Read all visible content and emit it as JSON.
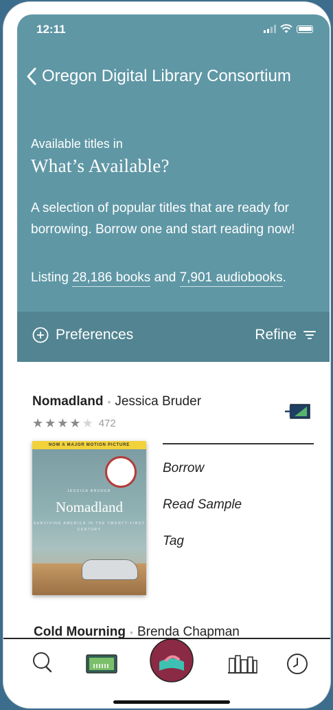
{
  "status": {
    "time": "12:11"
  },
  "header": {
    "back_label": "Oregon Digital Library Consortium",
    "available_in": "Available titles in",
    "title": "What’s Available?",
    "description": "A selection of popular titles that are ready for borrowing. Borrow one and start reading now!",
    "listing_prefix": "Listing",
    "books_count": "28,186 books",
    "and": "and",
    "audiobooks_count": "7,901 audiobooks",
    "listing_suffix": "."
  },
  "filterbar": {
    "preferences_label": "Preferences",
    "refine_label": "Refine"
  },
  "book": {
    "title": "Nomadland",
    "author": "Jessica Bruder",
    "rating_stars": 4,
    "rating_count": "472",
    "cover": {
      "banner": "NOW A MAJOR MOTION PICTURE",
      "author": "JESSICA BRUDER",
      "title": "Nomadland",
      "subtitle": "SURVIVING AMERICA IN THE TWENTY-FIRST CENTURY"
    },
    "actions": [
      "Borrow",
      "Read Sample",
      "Tag"
    ]
  },
  "next_book": {
    "title": "Cold Mourning",
    "author": "Brenda Chapman"
  },
  "colors": {
    "header": "#5f97a5",
    "filterbar": "#528491",
    "accent": "#8b2a44"
  },
  "tabs": [
    "search-icon",
    "library-card-icon",
    "home-logo-icon",
    "shelf-icon",
    "history-icon"
  ]
}
